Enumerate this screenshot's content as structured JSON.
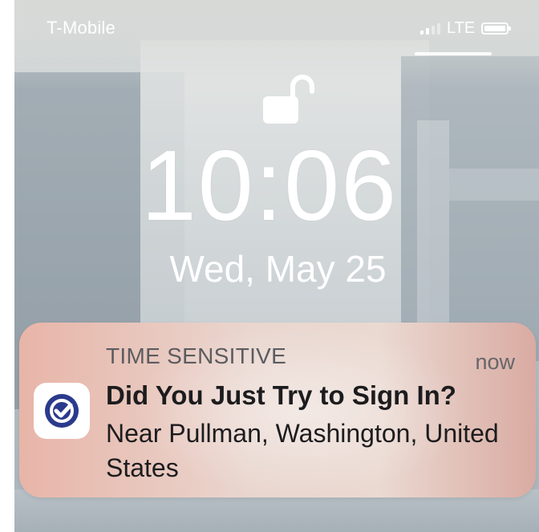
{
  "status_bar": {
    "carrier": "T-Mobile",
    "network": "LTE"
  },
  "lock_screen": {
    "time": "10:06",
    "date": "Wed, May 25"
  },
  "notification": {
    "label": "TIME SENSITIVE",
    "time": "now",
    "title": "Did You Just Try to Sign In?",
    "body": "Near Pullman, Washington, United States",
    "app_icon": "checkmark-badge-icon",
    "accent_color": "#2b3a8c"
  },
  "icons": [
    "lock-open-icon",
    "signal-bars-icon",
    "battery-icon"
  ]
}
